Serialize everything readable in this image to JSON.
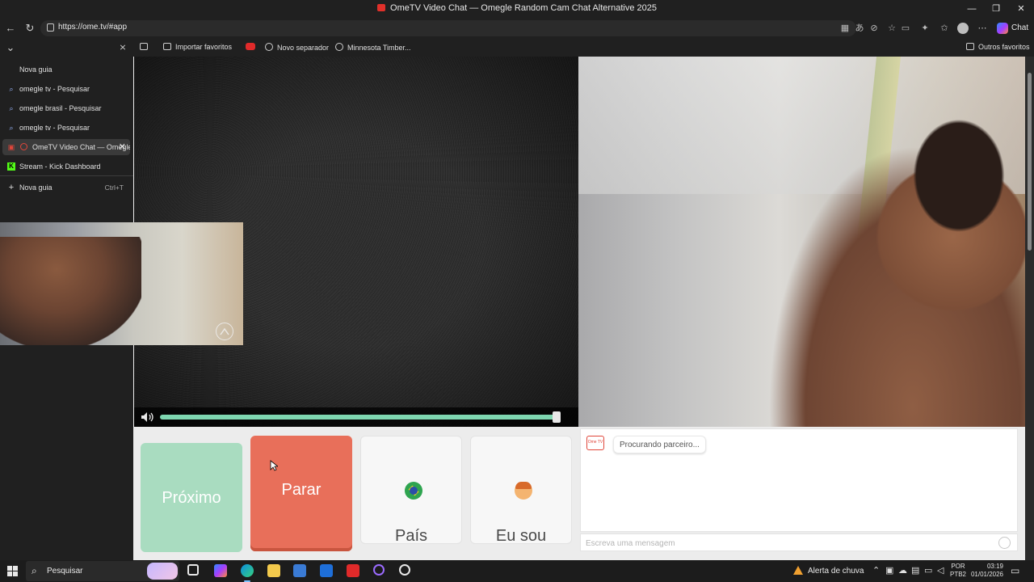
{
  "window": {
    "title": "OmeTV Video Chat — Omegle Random Cam Chat Alternative 2025",
    "minimize": "—",
    "maximize": "❐",
    "close": "✕"
  },
  "browser": {
    "url": "https://ome.tv/#app",
    "copilot_label": "Chat",
    "favorites": {
      "import": "Importar favoritos",
      "new_separator": "Novo separador",
      "minnesota": "Minnesota Timber...",
      "others": "Outros favoritos"
    }
  },
  "sidebar": {
    "tabs": [
      {
        "label": "Nova guia",
        "icon": "new-tab-icon"
      },
      {
        "label": "omegle tv - Pesquisar",
        "icon": "search-icon"
      },
      {
        "label": "omegle brasil - Pesquisar",
        "icon": "search-icon"
      },
      {
        "label": "omegle tv - Pesquisar",
        "icon": "search-icon"
      },
      {
        "label": "OmeTV Video Chat — Omegle",
        "icon": "ometv-icon",
        "active": true
      },
      {
        "label": "Stream - Kick Dashboard",
        "icon": "kick-icon"
      }
    ],
    "new_tab_label": "Nova guia",
    "new_tab_shortcut": "Ctrl+T"
  },
  "app": {
    "volume_level": 0.98,
    "buttons": {
      "next": "Próximo",
      "stop": "Parar",
      "country": "País",
      "iam": "Eu sou"
    },
    "chat": {
      "status": "Procurando parceiro...",
      "logo_text": "Ome TV",
      "input_placeholder": "Escreva uma mensagem"
    }
  },
  "taskbar": {
    "search_label": "Pesquisar",
    "weather": "Alerta de chuva",
    "lang_top": "POR",
    "lang_bottom": "PTB2",
    "time": "03:19",
    "date": "01/01/2026"
  },
  "colors": {
    "next_button": "#a9dcc0",
    "stop_button": "#e86f5a",
    "volume_fill": "#7ed6b0",
    "accent_logo": "#e0463a"
  }
}
